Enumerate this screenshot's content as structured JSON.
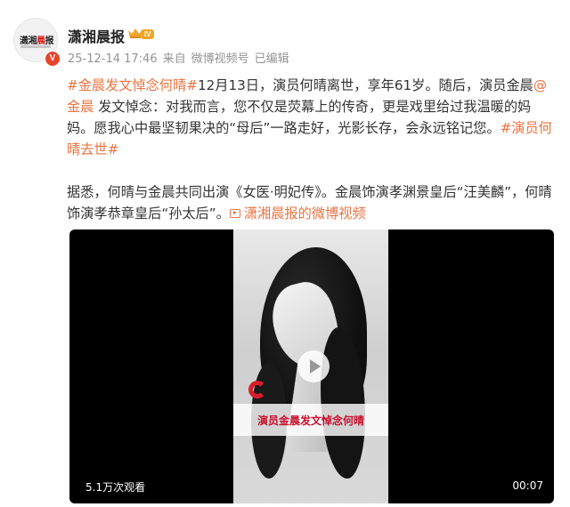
{
  "post": {
    "author": {
      "name": "潇湘晨报",
      "avatar_logo_black": "潇湘",
      "avatar_logo_red": "晨",
      "avatar_logo_black2": "报",
      "verified_badge": "V",
      "level_badge": "IV",
      "crown_icon": "crown-icon"
    },
    "meta": {
      "timestamp": "25-12-14 17:46",
      "source_prefix": "来自",
      "source": "微博视频号",
      "edited": "已编辑"
    },
    "text": {
      "hashtag1": "#金晨发文悼念何晴#",
      "line1_rest": "12月13日，演员何晴离世，享年61岁。随后，演员金晨",
      "mention_at": "@",
      "mention_name": "金晨",
      "line2_rest": " 发文悼念：对我而言，您不仅是荧幕上的传奇，更是戏里给过我温暖的妈",
      "line3": "妈。愿我心中最坚韧果决的“母后”一路走好，光影长存，会永远铭记您。",
      "hashtag2_a": "#演员何",
      "hashtag2_b": "晴去世#",
      "para2_line1": "据悉，何晴与金晨共同出演《女医·明妃传》。金晨饰演孝渊景皇后“汪美麟”，何晴",
      "para2_line2": "饰演孝恭章皇后“孙太后”。",
      "video_link": "潇湘晨报的微博视频"
    },
    "video": {
      "caption": "演员金晨发文悼念何晴",
      "views": "5.1万次观看",
      "duration": "00:07"
    }
  },
  "colors": {
    "link": "#eb7340",
    "badge_red": "#e8432d",
    "level_badge": "#f0a52c",
    "meta_gray": "#939393",
    "caption_red": "#c8102e"
  }
}
